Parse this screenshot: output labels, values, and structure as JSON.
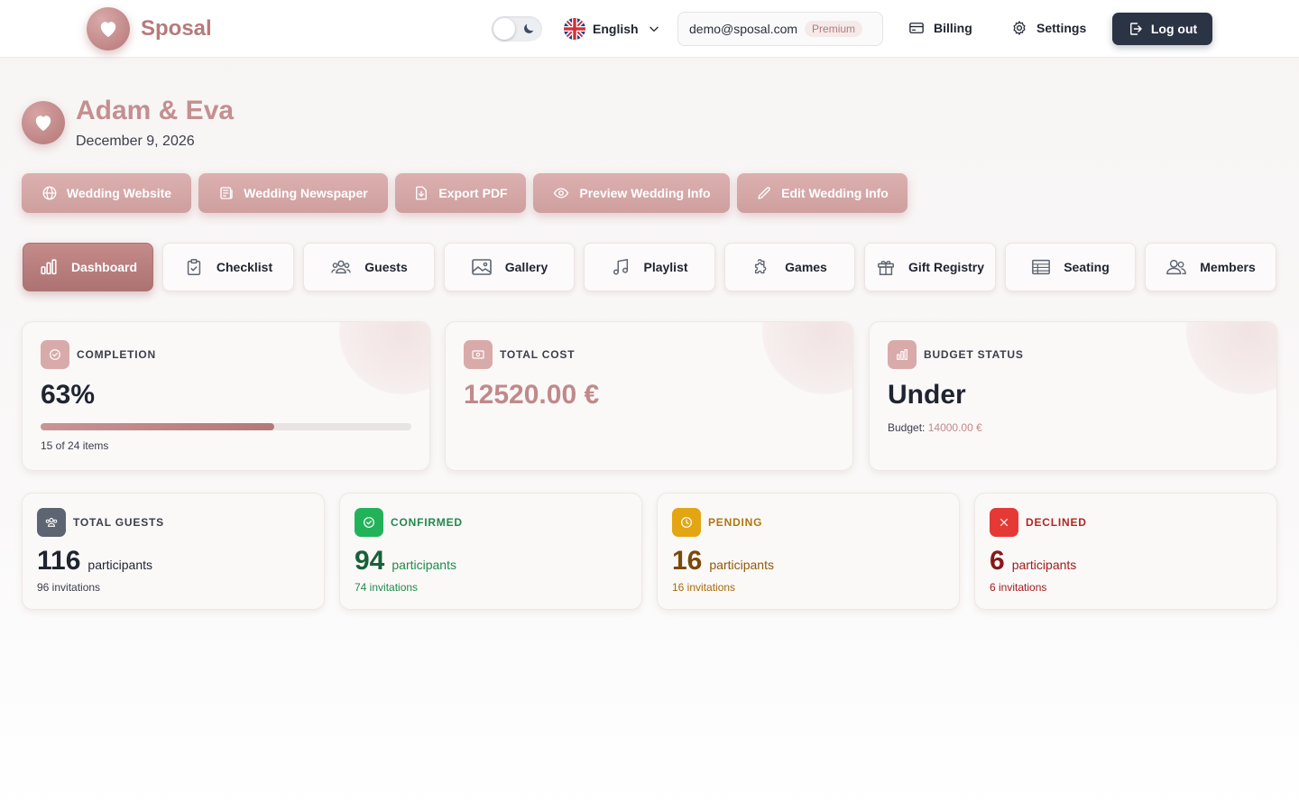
{
  "header": {
    "brand": "Sposal",
    "language": "English",
    "account_email": "demo@sposal.com",
    "plan_badge": "Premium",
    "billing": "Billing",
    "settings": "Settings",
    "logout": "Log out"
  },
  "wedding": {
    "couple": "Adam & Eva",
    "date": "December 9, 2026"
  },
  "actions": [
    {
      "label": "Wedding Website",
      "icon": "globe-icon"
    },
    {
      "label": "Wedding Newspaper",
      "icon": "newspaper-icon"
    },
    {
      "label": "Export PDF",
      "icon": "file-download-icon"
    },
    {
      "label": "Preview Wedding Info",
      "icon": "eye-icon"
    },
    {
      "label": "Edit Wedding Info",
      "icon": "pencil-icon"
    }
  ],
  "tabs": [
    {
      "label": "Dashboard",
      "icon": "bar-chart-icon",
      "active": true
    },
    {
      "label": "Checklist",
      "icon": "clipboard-check-icon"
    },
    {
      "label": "Guests",
      "icon": "users-icon"
    },
    {
      "label": "Gallery",
      "icon": "image-icon"
    },
    {
      "label": "Playlist",
      "icon": "music-note-icon"
    },
    {
      "label": "Games",
      "icon": "puzzle-icon"
    },
    {
      "label": "Gift Registry",
      "icon": "gift-icon"
    },
    {
      "label": "Seating",
      "icon": "table-icon"
    },
    {
      "label": "Members",
      "icon": "members-icon"
    }
  ],
  "stats": {
    "completion": {
      "label": "COMPLETION",
      "value": "63%",
      "progress": 0.63,
      "detail": "15 of 24 items"
    },
    "total_cost": {
      "label": "TOTAL COST",
      "value": "12520.00 €"
    },
    "budget": {
      "label": "BUDGET STATUS",
      "value": "Under",
      "budget_label": "Budget:",
      "budget_value": "14000.00 €"
    }
  },
  "guests": {
    "unit": "participants",
    "cards": [
      {
        "label": "TOTAL GUESTS",
        "count": "116",
        "invitations": "96 invitations",
        "color": "#1f2430",
        "icon_bg": "#5d6472"
      },
      {
        "label": "CONFIRMED",
        "count": "94",
        "invitations": "74 invitations",
        "color": "#1f8a4c",
        "icon_bg": "#22b35a"
      },
      {
        "label": "PENDING",
        "count": "16",
        "invitations": "16 invitations",
        "color": "#a86a0a",
        "icon_bg": "#e3a512"
      },
      {
        "label": "DECLINED",
        "count": "6",
        "invitations": "6 invitations",
        "color": "#a11d1d",
        "icon_bg": "#e53935"
      }
    ]
  },
  "colors": {
    "accent": "#b77a7a",
    "dark_button": "#2b3445"
  }
}
